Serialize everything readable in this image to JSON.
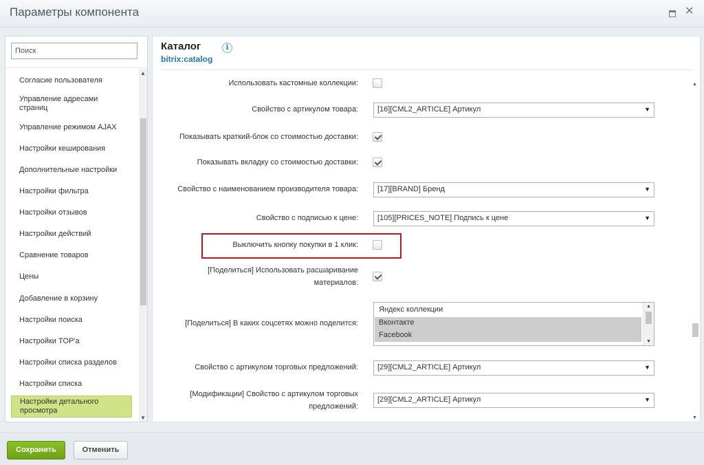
{
  "window": {
    "title": "Параметры компонента"
  },
  "sidebar": {
    "search_placeholder": "Поиск",
    "items": [
      {
        "label": "Согласие пользователя"
      },
      {
        "label": "Управление адресами страниц"
      },
      {
        "label": "Управление режимом AJAX"
      },
      {
        "label": "Настройки кеширования"
      },
      {
        "label": "Дополнительные настройки"
      },
      {
        "label": "Настройки фильтра"
      },
      {
        "label": "Настройки отзывов"
      },
      {
        "label": "Настройки действий"
      },
      {
        "label": "Сравнение товаров"
      },
      {
        "label": "Цены"
      },
      {
        "label": "Добавление в корзину"
      },
      {
        "label": "Настройки поиска"
      },
      {
        "label": "Настройки TOP'а"
      },
      {
        "label": "Настройки списка разделов"
      },
      {
        "label": "Настройки списка"
      },
      {
        "label": "Настройки детального просмотра",
        "active": true
      }
    ]
  },
  "component": {
    "title": "Каталог",
    "id": "bitrix:catalog",
    "info_icon": "i"
  },
  "rows": [
    {
      "label": "Использовать кастомные коллекции:",
      "type": "checkbox",
      "checked": false
    },
    {
      "label": "Свойство с артикулом товара:",
      "type": "select",
      "value": "[16][CML2_ARTICLE] Артикул"
    },
    {
      "label": "Показывать краткий-блок со стоимостью доставки:",
      "type": "checkbox",
      "checked": true
    },
    {
      "label": "Показывать вкладку со стоимостью доставки:",
      "type": "checkbox",
      "checked": true
    },
    {
      "label": "Свойство с наименованием производителя товара:",
      "type": "select",
      "value": "[17][BRAND] Бренд"
    },
    {
      "label": "Свойство с подписью к цене:",
      "type": "select",
      "value": "[105][PRICES_NOTE] Подпись к цене"
    },
    {
      "label": "Выключить кнопку покупки в 1 клик:",
      "type": "checkbox",
      "checked": false,
      "highlighted": true
    },
    {
      "label_line1": "[Поделиться] Использовать расшаривание",
      "label_line2": "материалов:",
      "type": "checkbox",
      "checked": true
    },
    {
      "label": "[Поделиться] В каких соцсетях можно поделится:",
      "type": "multiselect",
      "options": [
        {
          "label": "Яндекс коллекции",
          "selected": false
        },
        {
          "label": "Вконтакте",
          "selected": true
        },
        {
          "label": "Facebook",
          "selected": true
        }
      ]
    },
    {
      "label": "Свойство с артикулом торговых предложений:",
      "type": "select",
      "value": "[29][CML2_ARTICLE] Артикул"
    },
    {
      "label_line1": "[Модификации] Свойство с артикулом торговых",
      "label_line2": "предложений:",
      "type": "select",
      "value": "[29][CML2_ARTICLE] Артикул"
    }
  ],
  "footer": {
    "save_label": "Сохранить",
    "cancel_label": "Отменить"
  },
  "colors": {
    "accent_green": "#7aae1c",
    "active_item": "#cfe487",
    "highlight_border": "#c0141c",
    "link_blue": "#2675a8"
  }
}
